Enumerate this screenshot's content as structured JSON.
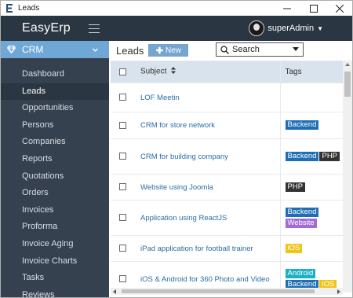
{
  "window": {
    "title": "Leads",
    "icon": "app-e-icon"
  },
  "topbar": {
    "logo": "EasyErp",
    "user": "superAdmin"
  },
  "sidebar": {
    "section": "CRM",
    "items": [
      {
        "label": "Dashboard",
        "active": false
      },
      {
        "label": "Leads",
        "active": true
      },
      {
        "label": "Opportunities",
        "active": false
      },
      {
        "label": "Persons",
        "active": false
      },
      {
        "label": "Companies",
        "active": false
      },
      {
        "label": "Reports",
        "active": false
      },
      {
        "label": "Quotations",
        "active": false
      },
      {
        "label": "Orders",
        "active": false
      },
      {
        "label": "Invoices",
        "active": false
      },
      {
        "label": "Proforma",
        "active": false
      },
      {
        "label": "Invoice Aging",
        "active": false
      },
      {
        "label": "Invoice Charts",
        "active": false
      },
      {
        "label": "Tasks",
        "active": false
      },
      {
        "label": "Reviews",
        "active": false
      }
    ]
  },
  "header": {
    "title": "Leads",
    "new_label": "New",
    "search_label": "Search"
  },
  "table": {
    "columns": {
      "subject": "Subject",
      "tags": "Tags"
    },
    "rows": [
      {
        "subject": "LOF Meetin",
        "tags": []
      },
      {
        "subject": "CRM for store network",
        "tags": [
          {
            "label": "Backend",
            "color": "#1f6fb5"
          }
        ]
      },
      {
        "subject": "CRM for building company",
        "tags": [
          {
            "label": "Backend",
            "color": "#1f6fb5"
          },
          {
            "label": "PHP",
            "color": "#333333"
          }
        ]
      },
      {
        "subject": "Website using Joomla",
        "tags": [
          {
            "label": "PHP",
            "color": "#333333"
          }
        ]
      },
      {
        "subject": "Application using ReactJS",
        "tags": [
          {
            "label": "Backend",
            "color": "#1f6fb5"
          },
          {
            "label": "Website",
            "color": "#a66bd3"
          }
        ]
      },
      {
        "subject": "iPad application for football trainer",
        "tags": [
          {
            "label": "iOS",
            "color": "#f0c419"
          }
        ]
      },
      {
        "subject": "iOS & Android for 360 Photo and Video",
        "tags": [
          {
            "label": "Android",
            "color": "#1bb1c4"
          },
          {
            "label": "Backend",
            "color": "#1f6fb5"
          },
          {
            "label": "iOS",
            "color": "#f0c419"
          }
        ]
      }
    ]
  }
}
